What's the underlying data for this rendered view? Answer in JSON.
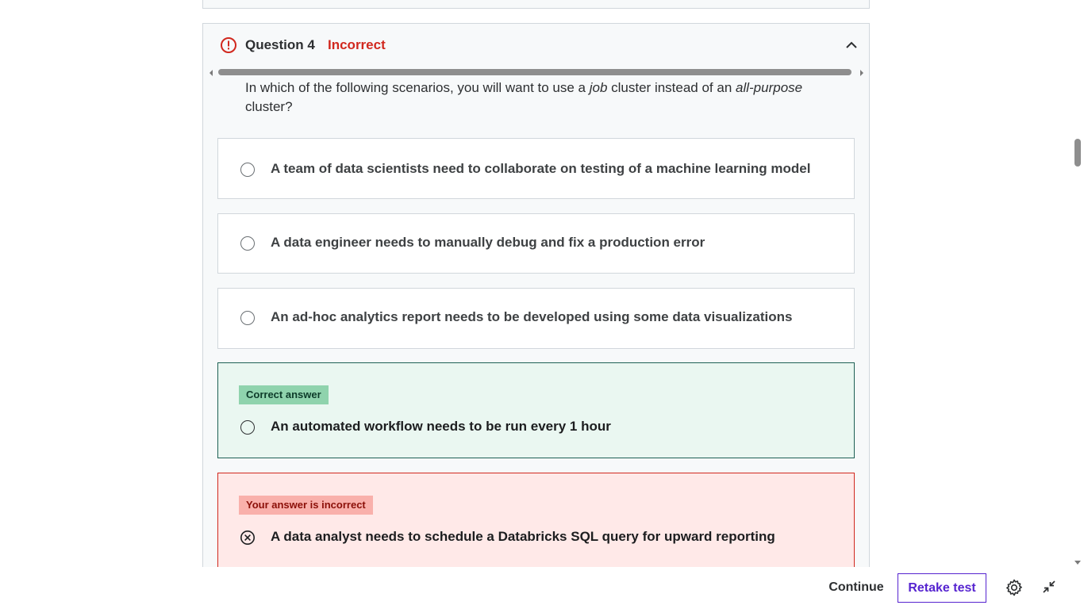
{
  "question": {
    "title": "Question 4",
    "status": "Incorrect",
    "text_before_job": "In which of the following scenarios, you will want to use a ",
    "text_job": "job",
    "text_middle": " cluster instead of an ",
    "text_all_purpose": "all-purpose",
    "text_after": " cluster?"
  },
  "options": [
    {
      "label": "A team of data scientists need to collaborate on testing of a machine learning model"
    },
    {
      "label": "A data engineer needs to manually debug and fix a production error"
    },
    {
      "label": "An ad-hoc analytics report needs to be developed using some data visualizations"
    }
  ],
  "correct_option": {
    "badge": "Correct answer",
    "label": "An automated workflow needs to be run every 1 hour"
  },
  "user_option": {
    "badge": "Your answer is incorrect",
    "label": "A data analyst needs to schedule a Databricks SQL query for upward reporting"
  },
  "footer": {
    "continue_label": "Continue",
    "retake_label": "Retake test"
  },
  "icons": {
    "alert": "alert-circle-icon",
    "collapse": "chevron-up-icon",
    "wrong": "x-circle-icon",
    "settings": "gear-icon",
    "exit_fullscreen": "collapse-arrows-icon"
  },
  "colors": {
    "incorrect": "#d1281e",
    "correct_bg": "#eaf7f1",
    "correct_badge": "#8fd3ad",
    "wrong_bg": "#ffe9e8",
    "wrong_badge": "#f9b0ab",
    "accent": "#5624d0"
  }
}
